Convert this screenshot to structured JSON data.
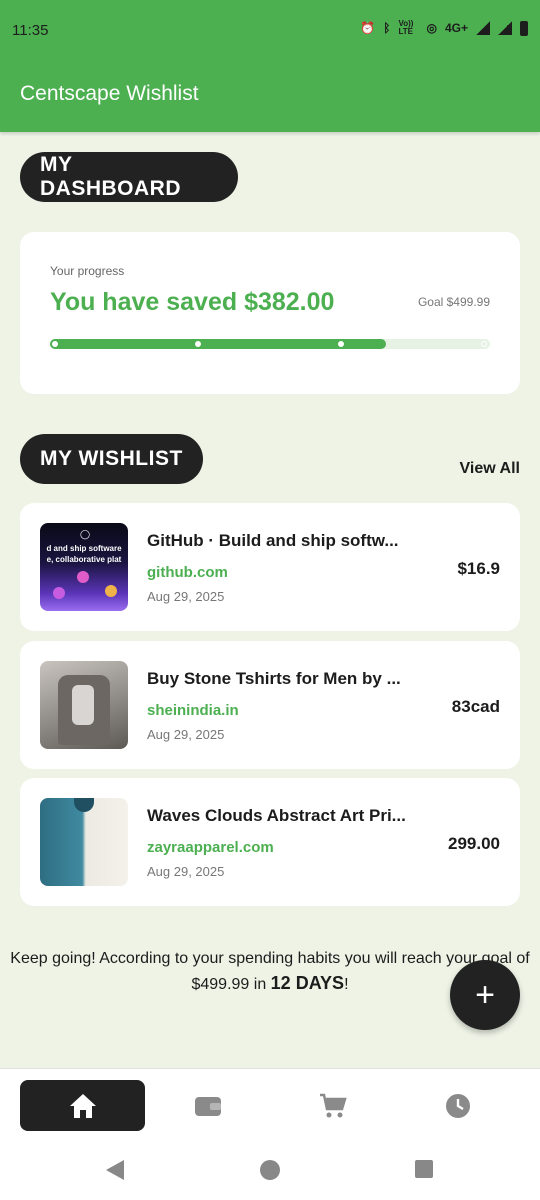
{
  "status_bar": {
    "time": "11:35",
    "icons": [
      "alarm-icon",
      "bluetooth-icon",
      "volte-icon",
      "hotspot-icon",
      "signal-4g-icon",
      "signal-icon",
      "battery-icon"
    ],
    "volte_label": "Vo)) LTE",
    "network_label": "4G+"
  },
  "app_bar": {
    "title": "Centscape Wishlist"
  },
  "dashboard": {
    "heading": "MY DASHBOARD",
    "progress_label": "Your progress",
    "saved_text": "You have saved $382.00",
    "goal_text": "Goal $499.99",
    "progress_fraction": 0.764
  },
  "wishlist": {
    "heading": "MY WISHLIST",
    "view_all": "View All",
    "items": [
      {
        "title": "GitHub · Build and ship softw...",
        "site": "github.com",
        "date": "Aug 29, 2025",
        "price": "$16.9",
        "thumb_text_1": "d and ship software",
        "thumb_text_2": "e, collaborative plat"
      },
      {
        "title": "Buy Stone Tshirts for Men by ...",
        "site": "sheinindia.in",
        "date": "Aug 29, 2025",
        "price": "83cad"
      },
      {
        "title": "Waves Clouds Abstract Art Pri...",
        "site": "zayraapparel.com",
        "date": "Aug 29, 2025",
        "price": "299.00"
      }
    ]
  },
  "footer": {
    "message_before": "Keep going! According to your spending habits you will reach your goal of $499.99 in ",
    "days": "12 DAYS",
    "message_after": "!"
  },
  "fab": {
    "label": "+"
  },
  "bottom_nav": {
    "items": [
      "home-icon",
      "wallet-icon",
      "cart-icon",
      "history-icon"
    ],
    "active_index": 0
  },
  "colors": {
    "accent": "#4caf50",
    "dark": "#222222",
    "background": "#eef3e6",
    "track": "#e6f2e4"
  }
}
